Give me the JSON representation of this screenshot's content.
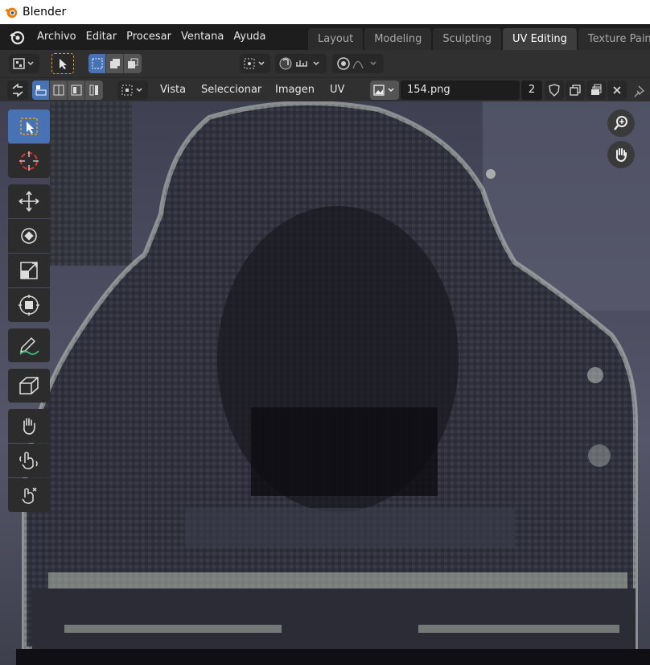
{
  "window": {
    "title": "Blender"
  },
  "menu": {
    "items": [
      "Archivo",
      "Editar",
      "Procesar",
      "Ventana",
      "Ayuda"
    ]
  },
  "workspaces": {
    "tabs": [
      {
        "label": "Layout",
        "active": false
      },
      {
        "label": "Modeling",
        "active": false
      },
      {
        "label": "Sculpting",
        "active": false
      },
      {
        "label": "UV Editing",
        "active": true
      },
      {
        "label": "Texture Paint",
        "active": false
      }
    ]
  },
  "uv_header": {
    "menus": [
      "Vista",
      "Seleccionar",
      "Imagen",
      "UV"
    ],
    "image_name": "154.png",
    "users": "2"
  },
  "toolbar": {
    "tools": [
      "select-box",
      "cursor",
      "move",
      "rotate",
      "scale",
      "transform",
      "annotate",
      "rip-region",
      "grab",
      "relax",
      "pinch"
    ],
    "active_tool": "select-box"
  },
  "colors": {
    "accent": "#4772b3",
    "header": "#303030",
    "background": "#1d1d1d",
    "blender_orange": "#e87d0d"
  }
}
